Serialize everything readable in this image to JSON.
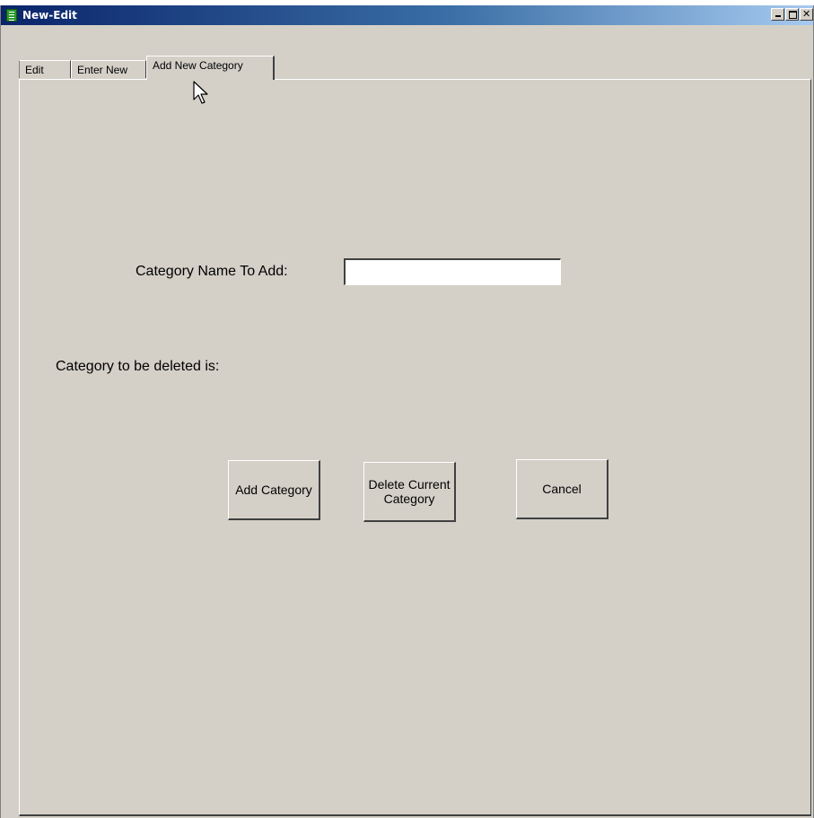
{
  "window": {
    "title": "New-Edit",
    "controls": {
      "minimize": "_",
      "maximize": "□",
      "close": "×"
    }
  },
  "tabs": [
    {
      "label": "Edit",
      "active": false
    },
    {
      "label": "Enter New",
      "active": false
    },
    {
      "label": "Add New Category",
      "active": true
    }
  ],
  "form": {
    "category_name_label": "Category Name To Add:",
    "category_name_value": "",
    "delete_label": "Category to be deleted is:"
  },
  "buttons": {
    "add": "Add Category",
    "delete": "Delete Current Category",
    "cancel": "Cancel"
  },
  "icons": {
    "app": "notepad-icon",
    "cursor": "mouse-pointer-icon"
  }
}
